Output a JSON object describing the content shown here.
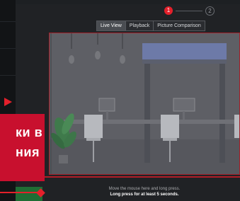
{
  "stepper": {
    "steps": [
      "1",
      "2"
    ],
    "active_step": 1,
    "accent_color": "#e4202b"
  },
  "tabs": [
    {
      "label": "Live View",
      "active": true
    },
    {
      "label": "Playback",
      "active": false
    },
    {
      "label": "Picture Comparison",
      "active": false
    }
  ],
  "preview": {
    "border_color": "#a3202a"
  },
  "hint": {
    "line1": "Move the mouse here and long press.",
    "line2": "Long press for at least 5 seconds."
  },
  "overlay": {
    "line1": "ки в",
    "line2": "ния",
    "color": "#c8102e"
  }
}
